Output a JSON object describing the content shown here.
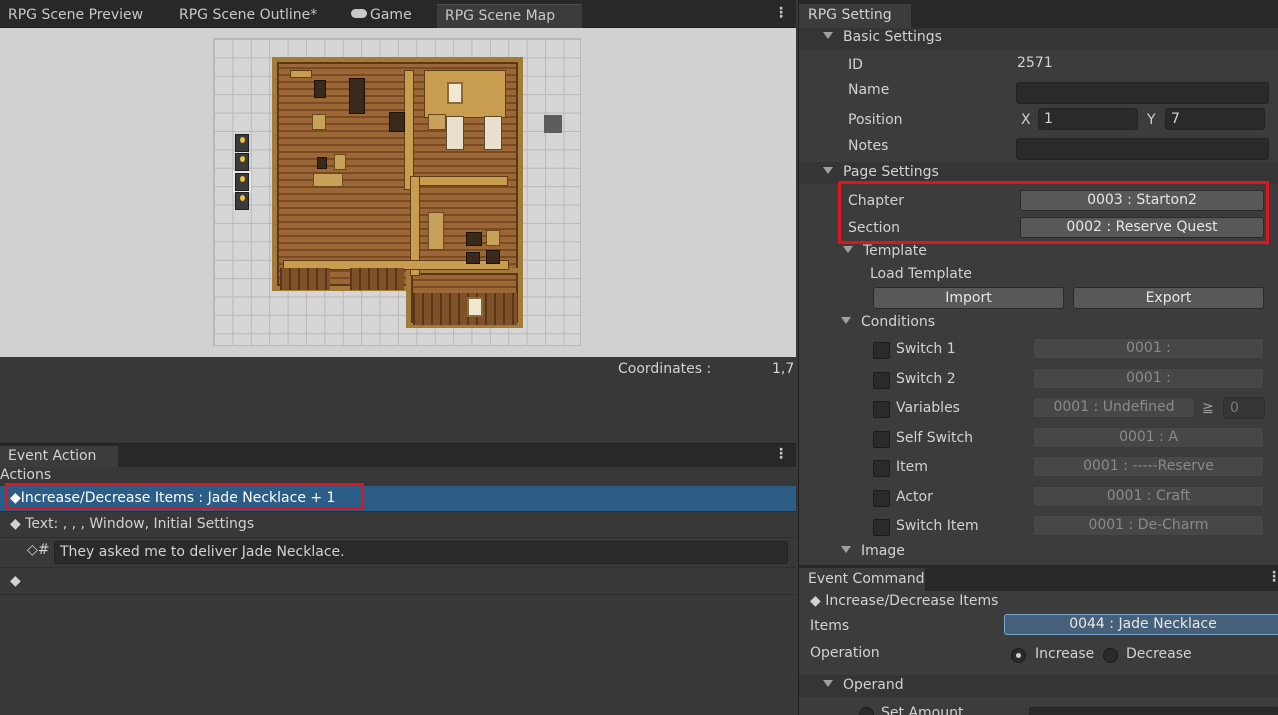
{
  "left_tabs": [
    "RPG Scene Preview",
    "RPG Scene Outline*",
    "Game",
    "RPG Scene Map"
  ],
  "coordinates": {
    "label": "Coordinates :",
    "value": "1,7"
  },
  "event_action": {
    "tab": "Event Action",
    "header": "Actions",
    "rows": [
      "◆Increase/Decrease Items : Jade Necklace + 1",
      "◆ Text: , , , Window, Initial Settings",
      "◇#",
      "◆"
    ],
    "text_value": "They asked me to deliver Jade Necklace."
  },
  "rpg_setting": {
    "tab": "RPG Setting",
    "basic_settings": "Basic Settings",
    "id_label": "ID",
    "id_value": "2571",
    "name_label": "Name",
    "name_value": "",
    "position_label": "Position",
    "x_label": "X",
    "x_value": "1",
    "y_label": "Y",
    "y_value": "7",
    "notes_label": "Notes",
    "notes_value": "",
    "page_settings": "Page Settings",
    "chapter_label": "Chapter",
    "chapter_value": "0003 : Starton2",
    "section_label": "Section",
    "section_value": "0002 : Reserve Quest",
    "template": "Template",
    "load_template": "Load Template",
    "import": "Import",
    "export": "Export",
    "conditions": "Conditions",
    "condition_rows": [
      {
        "label": "Switch 1",
        "value": "0001 :"
      },
      {
        "label": "Switch 2",
        "value": "0001 :"
      },
      {
        "label": "Variables",
        "value": "0001 : Undefined"
      },
      {
        "label": "Self Switch",
        "value": "0001 : A"
      },
      {
        "label": "Item",
        "value": "0001 : -----Reserve"
      },
      {
        "label": "Actor",
        "value": "0001 : Craft"
      },
      {
        "label": "Switch Item",
        "value": "0001 : De-Charm"
      }
    ],
    "variables_op": "≧",
    "variables_amount": "0",
    "image": "Image"
  },
  "event_command": {
    "tab": "Event Command",
    "title": "◆ Increase/Decrease Items",
    "items_label": "Items",
    "items_value": "0044 : Jade Necklace",
    "operation_label": "Operation",
    "increase": "Increase",
    "decrease": "Decrease",
    "operand": "Operand",
    "set_amount": "Set Amount"
  },
  "colors": {
    "selection": "#2c5d87",
    "highlight_box": "#e0141c"
  }
}
